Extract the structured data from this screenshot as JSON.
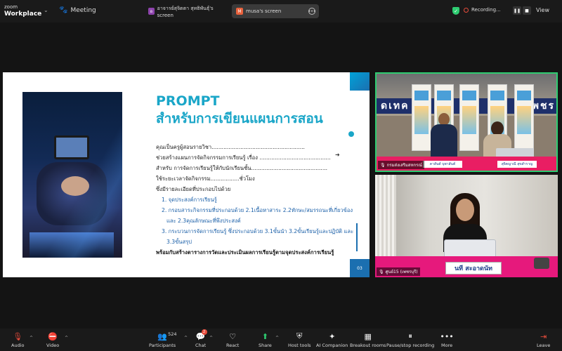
{
  "app": {
    "logo_line1": "zoom",
    "logo_line2": "Workplace",
    "meeting_label": "Meeting"
  },
  "tabs": [
    {
      "badge": "อ",
      "label": "อาจารย์สุจิตตา สุทธิพันธุ์'s screen"
    },
    {
      "badge": "M",
      "label": "musa's screen"
    }
  ],
  "recording": {
    "label": "Recording..."
  },
  "view_label": "View",
  "slide": {
    "title": "PROMPT",
    "subtitle": "สำหรับการเขียนแผนการสอน",
    "page_number": "03",
    "lines": [
      "คุณเป็นครูผู้สอนรายวิชา.......................................................",
      "ช่วยสร้างแผนการจัดกิจกรรมการเรียนรู้ เรื่อง ..........................................",
      "สำหรับ การจัดการเรียนรู้ให้กับนักเรียนชั้น.............................................",
      "ใช้ระยะเวลาจัดกิจกรรม.................ชั่วโมง",
      "ซึ่งมีรายละเอียดที่ประกอบไปด้วย"
    ],
    "items": [
      "1. จุดประสงค์การเรียนรู้",
      "2. กรอบสาระกิจกรรมที่ประกอบด้วย 2.1เนื้อหาสาระ 2.2ทักษะ/สมรรถนะที่เกี่ยวข้อง",
      "และ 2.3คุณลักษณะที่พึงประสงค์",
      "3. กระบวนการจัดการเรียนรู้ ซึ่งประกอบด้วย 3.1ขั้นนำ 3.2ขั้นเรียนรู้และปฏิบัติ และ",
      "3.3ขั้นสรุป"
    ],
    "closing": "พร้อมกับสร้างตารางการวัดและประเมินผลการเรียนรู้ตามจุดประสงค์การเรียนรู้"
  },
  "tile1": {
    "sign": "ดเทค",
    "sign_right": "เพชร",
    "nameplate_left": "คาสันต์ บุพาสันต์",
    "nameplate_right": "สุจิตญาณี สุขสำราญ",
    "label": "กรมส่งเสริมสหกรณ์"
  },
  "tile2": {
    "nameplate": "นที สะอาดนัท",
    "label": "ศูนย์15 (เพชรบุรี)"
  },
  "toolbar": {
    "audio": "Audio",
    "video": "Video",
    "participants": "Participants",
    "participant_count": "524",
    "chat": "Chat",
    "chat_badge": "2",
    "react": "React",
    "share": "Share",
    "host_tools": "Host tools",
    "ai_companion": "AI Companion",
    "breakout_rooms": "Breakout rooms",
    "pause_recording": "Pause/stop recording",
    "more": "More",
    "leave": "Leave"
  }
}
